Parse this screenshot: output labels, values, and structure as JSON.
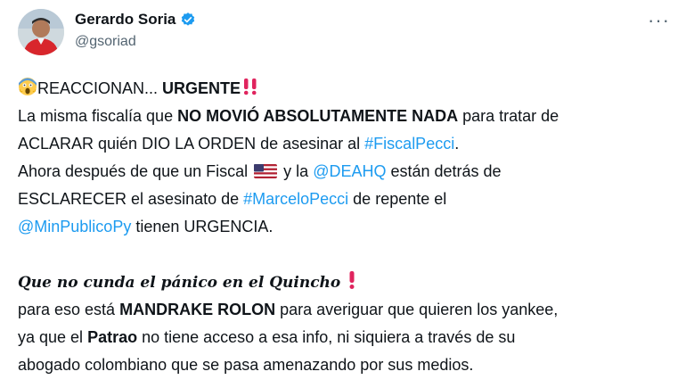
{
  "author": {
    "name": "Gerardo Soria",
    "handle": "@gsoriad"
  },
  "icons": {
    "more": "more-options-icon",
    "verified": "verified-badge-icon",
    "scream": "face-screaming-emoji",
    "double_exclamation": "double-exclamation-emoji",
    "exclamation": "exclamation-emoji",
    "flag": "us-flag-emoji"
  },
  "colors": {
    "link": "#1d9bf0",
    "text": "#0f1419",
    "muted": "#536471",
    "accent_red": "#e0245e"
  },
  "tweet": {
    "l1_a": "REACCIONAN... ",
    "l1_b": "URGENTE",
    "l2_a": "La misma fiscalía que ",
    "l2_b": "NO MOVIÓ ABSOLUTAMENTE NADA",
    "l2_c": " para tratar de",
    "l3_a": "ACLARAR quién DIO LA ORDEN de asesinar al ",
    "l3_link": "#FiscalPecci",
    "l3_b": ".",
    "l4_a": "Ahora después de que un Fiscal ",
    "l4_b": " y la ",
    "l4_link": "@DEAHQ",
    "l4_c": " están detrás de",
    "l5_a": "ESCLARECER el asesinato de ",
    "l5_link": "#MarceloPecci",
    "l5_b": " de repente el",
    "l6_link": "@MinPublicoPy",
    "l6_a": " tienen URGENCIA.",
    "l7": "Que no cunda el pánico en el Quincho ",
    "l8_a": "para eso está ",
    "l8_b": "MANDRAKE ROLON",
    "l8_c": " para averiguar que quieren los yankee,",
    "l9_a": "ya que el ",
    "l9_b": "Patrao",
    "l9_c": " no tiene acceso a esa info, ni siquiera a través de su",
    "l10": "abogado colombiano que se pasa amenazando por sus medios."
  }
}
